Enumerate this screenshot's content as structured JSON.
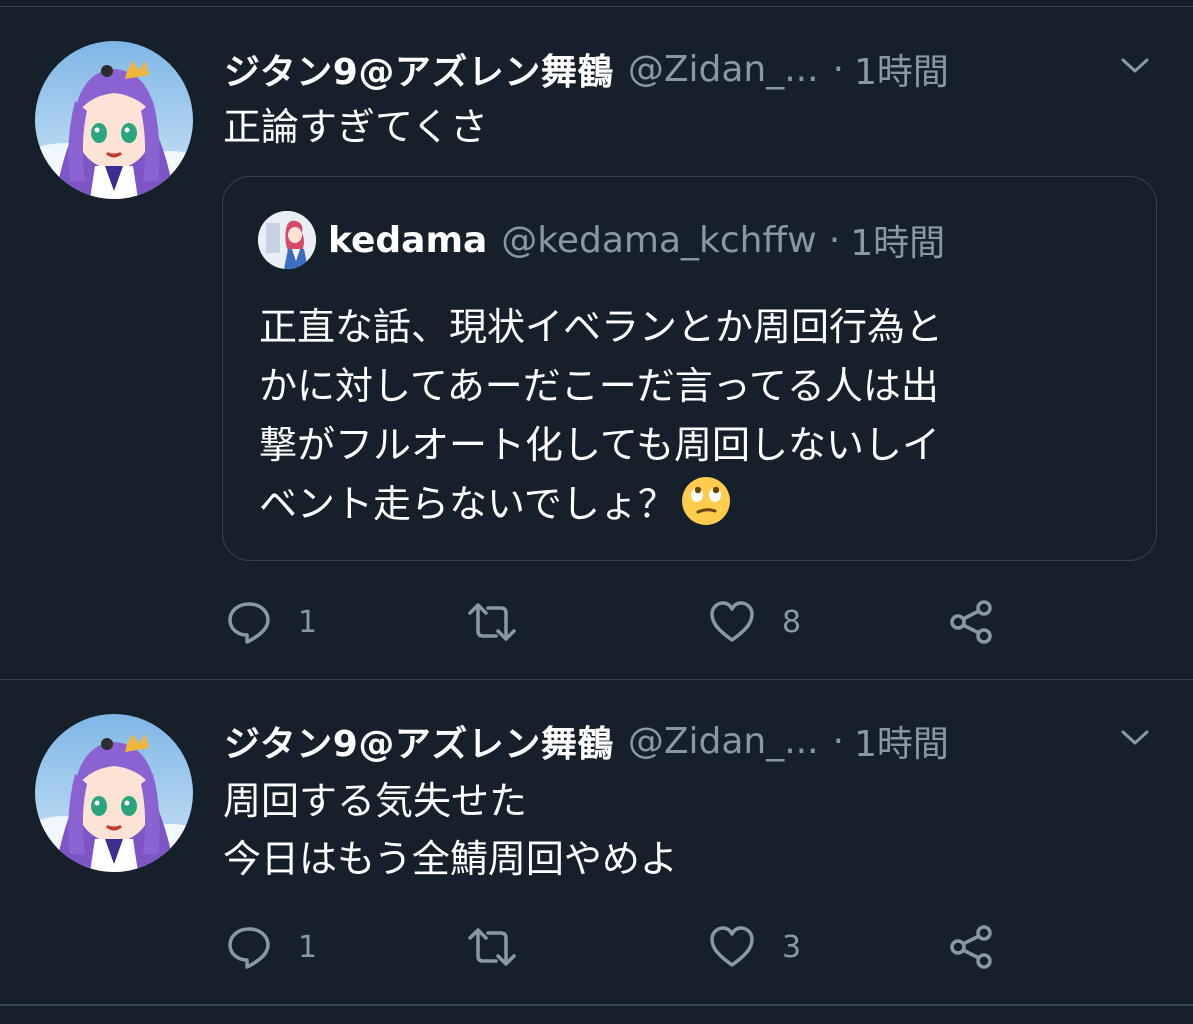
{
  "colors": {
    "background": "#15202b",
    "divider": "#38444d",
    "text_primary": "#ffffff",
    "text_secondary": "#8899a6"
  },
  "tweets": [
    {
      "display_name": "ジタン9@アズレン舞鶴",
      "handle": "@Zidan_...",
      "separator": "·",
      "time": "1時間",
      "text_lines": [
        "正論すぎてくさ"
      ],
      "quote": {
        "display_name": "kedama",
        "handle": "@kedama_kchffw",
        "separator": "·",
        "time": "1時間",
        "text_lines": [
          "正直な話、現状イベランとか周回行為と",
          "かに対してあーだこーだ言ってる人は出",
          "撃がフルオート化しても周回しないしイ",
          "ベント走らないでしょ？"
        ],
        "emoji": "face-with-rolling-eyes"
      },
      "actions": {
        "reply_count": "1",
        "retweet_count": "",
        "like_count": "8"
      }
    },
    {
      "display_name": "ジタン9@アズレン舞鶴",
      "handle": "@Zidan_...",
      "separator": "·",
      "time": "1時間",
      "text_lines": [
        "周回する気失せた",
        "今日はもう全鯖周回やめよ"
      ],
      "actions": {
        "reply_count": "1",
        "retweet_count": "",
        "like_count": "3"
      }
    }
  ],
  "icons": {
    "reply": "reply-icon",
    "retweet": "retweet-icon",
    "like": "heart-icon",
    "share": "share-icon",
    "menu": "chevron-down-icon"
  }
}
